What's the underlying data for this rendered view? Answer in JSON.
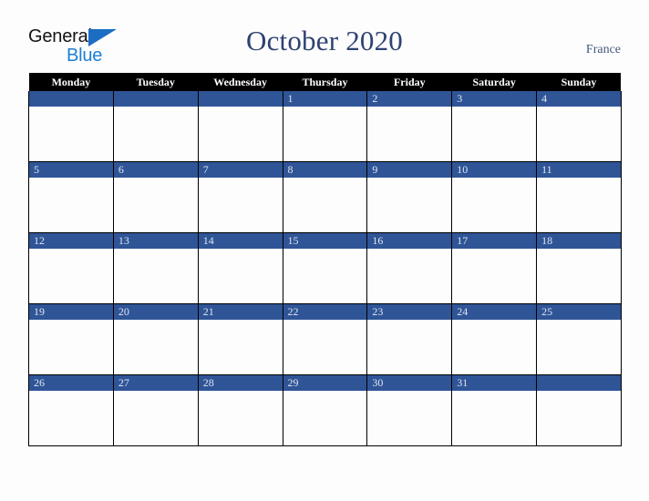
{
  "logo": {
    "primary_text": "General",
    "secondary_text": "Blue",
    "primary_color": "#141414",
    "secondary_color": "#1b7fd4",
    "triangle_color": "#1b6ec2"
  },
  "header": {
    "title": "October 2020",
    "country": "France",
    "title_color": "#2e4372"
  },
  "theme": {
    "accent_blue": "#2f5597",
    "header_black": "#000000",
    "page_background": "#fdfdfd",
    "day_number_color": "#dfe5f0"
  },
  "calendar": {
    "month": "October",
    "year": "2020",
    "weekday_headers": [
      "Monday",
      "Tuesday",
      "Wednesday",
      "Thursday",
      "Friday",
      "Saturday",
      "Sunday"
    ],
    "weeks": [
      [
        "",
        "",
        "",
        "1",
        "2",
        "3",
        "4"
      ],
      [
        "5",
        "6",
        "7",
        "8",
        "9",
        "10",
        "11"
      ],
      [
        "12",
        "13",
        "14",
        "15",
        "16",
        "17",
        "18"
      ],
      [
        "19",
        "20",
        "21",
        "22",
        "23",
        "24",
        "25"
      ],
      [
        "26",
        "27",
        "28",
        "29",
        "30",
        "31",
        ""
      ]
    ]
  }
}
